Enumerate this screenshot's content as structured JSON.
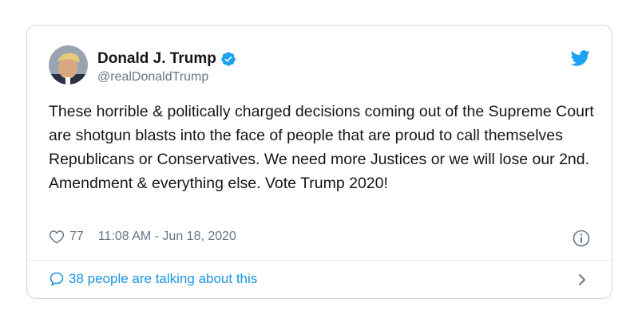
{
  "tweet": {
    "author_name": "Donald J. Trump",
    "handle": "@realDonaldTrump",
    "text": "These horrible & politically charged decisions coming out of the Supreme Court are shotgun blasts into the face of people that are proud to call themselves Republicans or Conservatives. We need more Justices or we will lose our 2nd. Amendment & everything else. Vote Trump 2020!",
    "likes": "77",
    "timestamp": "11:08 AM - Jun 18, 2020",
    "talking": "38 people are talking about this"
  },
  "icons": {
    "verified": "verified-badge-icon",
    "brand": "twitter-bird-icon",
    "like": "heart-icon",
    "info": "info-icon",
    "reply": "speech-bubble-icon",
    "chevron": "chevron-right-icon"
  },
  "colors": {
    "accent": "#1da1f2",
    "link": "#1b95e0",
    "text": "#14171a",
    "muted": "#657786",
    "border": "#cfd9de"
  }
}
